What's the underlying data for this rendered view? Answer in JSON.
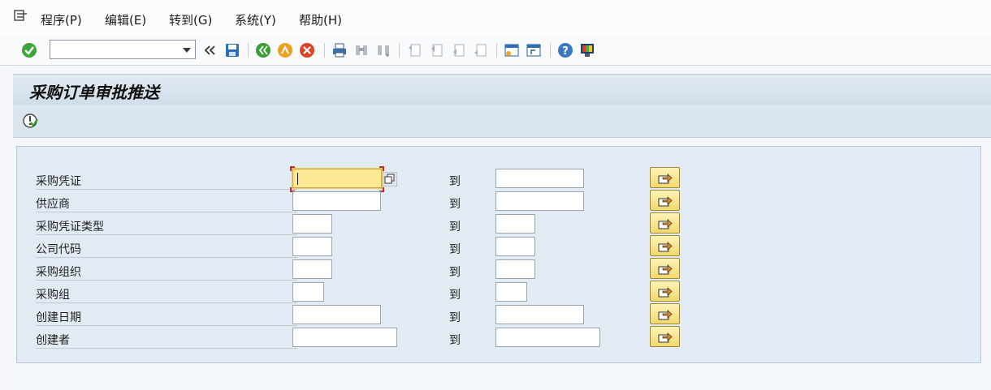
{
  "menu": {
    "items": [
      {
        "label": "程序(P)"
      },
      {
        "label": "编辑(E)"
      },
      {
        "label": "转到(G)"
      },
      {
        "label": "系统(Y)"
      },
      {
        "label": "帮助(H)"
      }
    ]
  },
  "toolbar": {
    "command_field_value": "",
    "icons": [
      "enter-icon",
      "back-icon",
      "save-icon",
      "back-green-icon",
      "exit-icon",
      "cancel-icon",
      "print-icon",
      "find-icon",
      "find-next-icon",
      "first-page-icon",
      "prev-page-icon",
      "next-page-icon",
      "last-page-icon",
      "new-session-icon",
      "shortcut-icon",
      "help-icon",
      "customize-icon"
    ]
  },
  "screen": {
    "title": "采购订单审批推送"
  },
  "selection": {
    "to_label": "到",
    "rows": [
      {
        "label": "采购凭证",
        "from": "",
        "to": ""
      },
      {
        "label": "供应商",
        "from": "",
        "to": ""
      },
      {
        "label": "采购凭证类型",
        "from": "",
        "to": ""
      },
      {
        "label": "公司代码",
        "from": "",
        "to": ""
      },
      {
        "label": "采购组织",
        "from": "",
        "to": ""
      },
      {
        "label": "采购组",
        "from": "",
        "to": ""
      },
      {
        "label": "创建日期",
        "from": "",
        "to": ""
      },
      {
        "label": "创建者",
        "from": "",
        "to": ""
      }
    ]
  },
  "colors": {
    "title_bar": "#cfdde9",
    "panel": "#e2ebf3",
    "focus_field": "#fde993",
    "multi_button": "#f2d96c"
  }
}
